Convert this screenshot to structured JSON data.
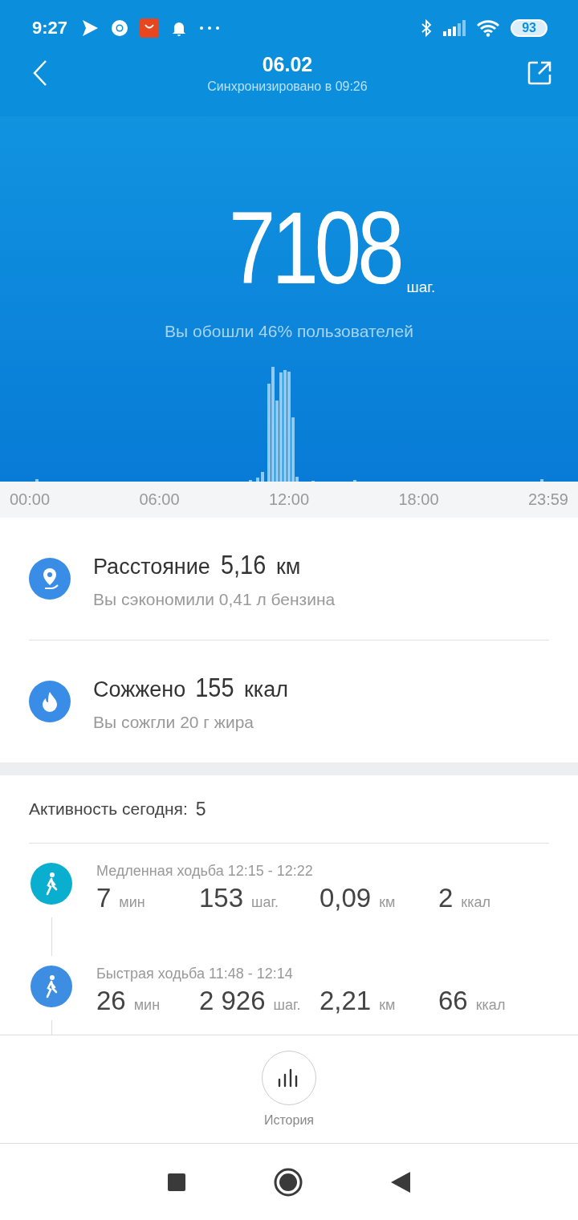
{
  "status_bar": {
    "time": "9:27",
    "battery": "93"
  },
  "header": {
    "title": "06.02",
    "subtitle": "Синхронизировано в 09:26"
  },
  "summary": {
    "steps": "7108",
    "unit": "шаг.",
    "comparison": "Вы обошли 46% пользователей"
  },
  "timeline": {
    "labels": [
      "00:00",
      "06:00",
      "12:00",
      "18:00",
      "23:59"
    ]
  },
  "metrics": [
    {
      "kind": "distance",
      "label": "Расстояние",
      "value": "5,16",
      "unit": "км",
      "note": "Вы сэкономили 0,41 л бензина"
    },
    {
      "kind": "calories",
      "label": "Сожжено",
      "value": "155",
      "unit": "ккал",
      "note": "Вы сожгли 20 г жира"
    }
  ],
  "activity": {
    "title": "Активность сегодня:",
    "count": "5",
    "items": [
      {
        "title": "Медленная ходьба 12:15 - 12:22",
        "color": "#0aafd0",
        "stats": [
          {
            "value": "7",
            "unit": "мин"
          },
          {
            "value": "153",
            "unit": "шаг."
          },
          {
            "value": "0,09",
            "unit": "км"
          },
          {
            "value": "2",
            "unit": "ккал"
          }
        ]
      },
      {
        "title": "Быстрая ходьба 11:48 - 12:14",
        "color": "#3d8ee2",
        "stats": [
          {
            "value": "26",
            "unit": "мин"
          },
          {
            "value": "2 926",
            "unit": "шаг."
          },
          {
            "value": "2,21",
            "unit": "км"
          },
          {
            "value": "66",
            "unit": "ккал"
          }
        ]
      }
    ]
  },
  "bottom_tab": {
    "label": "История"
  }
}
